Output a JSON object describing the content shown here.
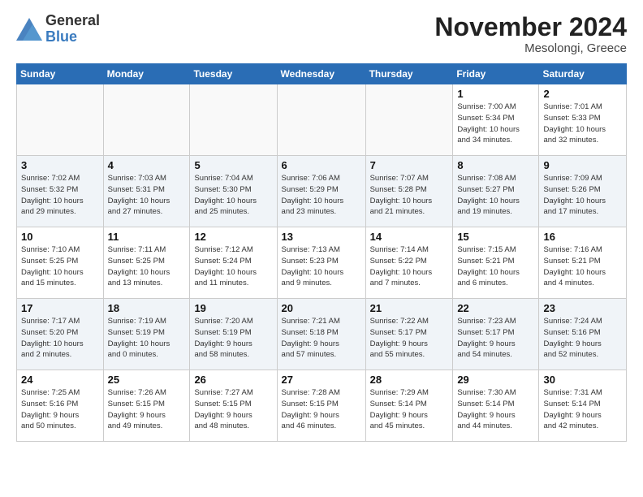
{
  "header": {
    "logo_general": "General",
    "logo_blue": "Blue",
    "month_title": "November 2024",
    "location": "Mesolongi, Greece"
  },
  "days_of_week": [
    "Sunday",
    "Monday",
    "Tuesday",
    "Wednesday",
    "Thursday",
    "Friday",
    "Saturday"
  ],
  "weeks": [
    [
      {
        "day": "",
        "info": ""
      },
      {
        "day": "",
        "info": ""
      },
      {
        "day": "",
        "info": ""
      },
      {
        "day": "",
        "info": ""
      },
      {
        "day": "",
        "info": ""
      },
      {
        "day": "1",
        "info": "Sunrise: 7:00 AM\nSunset: 5:34 PM\nDaylight: 10 hours\nand 34 minutes."
      },
      {
        "day": "2",
        "info": "Sunrise: 7:01 AM\nSunset: 5:33 PM\nDaylight: 10 hours\nand 32 minutes."
      }
    ],
    [
      {
        "day": "3",
        "info": "Sunrise: 7:02 AM\nSunset: 5:32 PM\nDaylight: 10 hours\nand 29 minutes."
      },
      {
        "day": "4",
        "info": "Sunrise: 7:03 AM\nSunset: 5:31 PM\nDaylight: 10 hours\nand 27 minutes."
      },
      {
        "day": "5",
        "info": "Sunrise: 7:04 AM\nSunset: 5:30 PM\nDaylight: 10 hours\nand 25 minutes."
      },
      {
        "day": "6",
        "info": "Sunrise: 7:06 AM\nSunset: 5:29 PM\nDaylight: 10 hours\nand 23 minutes."
      },
      {
        "day": "7",
        "info": "Sunrise: 7:07 AM\nSunset: 5:28 PM\nDaylight: 10 hours\nand 21 minutes."
      },
      {
        "day": "8",
        "info": "Sunrise: 7:08 AM\nSunset: 5:27 PM\nDaylight: 10 hours\nand 19 minutes."
      },
      {
        "day": "9",
        "info": "Sunrise: 7:09 AM\nSunset: 5:26 PM\nDaylight: 10 hours\nand 17 minutes."
      }
    ],
    [
      {
        "day": "10",
        "info": "Sunrise: 7:10 AM\nSunset: 5:25 PM\nDaylight: 10 hours\nand 15 minutes."
      },
      {
        "day": "11",
        "info": "Sunrise: 7:11 AM\nSunset: 5:25 PM\nDaylight: 10 hours\nand 13 minutes."
      },
      {
        "day": "12",
        "info": "Sunrise: 7:12 AM\nSunset: 5:24 PM\nDaylight: 10 hours\nand 11 minutes."
      },
      {
        "day": "13",
        "info": "Sunrise: 7:13 AM\nSunset: 5:23 PM\nDaylight: 10 hours\nand 9 minutes."
      },
      {
        "day": "14",
        "info": "Sunrise: 7:14 AM\nSunset: 5:22 PM\nDaylight: 10 hours\nand 7 minutes."
      },
      {
        "day": "15",
        "info": "Sunrise: 7:15 AM\nSunset: 5:21 PM\nDaylight: 10 hours\nand 6 minutes."
      },
      {
        "day": "16",
        "info": "Sunrise: 7:16 AM\nSunset: 5:21 PM\nDaylight: 10 hours\nand 4 minutes."
      }
    ],
    [
      {
        "day": "17",
        "info": "Sunrise: 7:17 AM\nSunset: 5:20 PM\nDaylight: 10 hours\nand 2 minutes."
      },
      {
        "day": "18",
        "info": "Sunrise: 7:19 AM\nSunset: 5:19 PM\nDaylight: 10 hours\nand 0 minutes."
      },
      {
        "day": "19",
        "info": "Sunrise: 7:20 AM\nSunset: 5:19 PM\nDaylight: 9 hours\nand 58 minutes."
      },
      {
        "day": "20",
        "info": "Sunrise: 7:21 AM\nSunset: 5:18 PM\nDaylight: 9 hours\nand 57 minutes."
      },
      {
        "day": "21",
        "info": "Sunrise: 7:22 AM\nSunset: 5:17 PM\nDaylight: 9 hours\nand 55 minutes."
      },
      {
        "day": "22",
        "info": "Sunrise: 7:23 AM\nSunset: 5:17 PM\nDaylight: 9 hours\nand 54 minutes."
      },
      {
        "day": "23",
        "info": "Sunrise: 7:24 AM\nSunset: 5:16 PM\nDaylight: 9 hours\nand 52 minutes."
      }
    ],
    [
      {
        "day": "24",
        "info": "Sunrise: 7:25 AM\nSunset: 5:16 PM\nDaylight: 9 hours\nand 50 minutes."
      },
      {
        "day": "25",
        "info": "Sunrise: 7:26 AM\nSunset: 5:15 PM\nDaylight: 9 hours\nand 49 minutes."
      },
      {
        "day": "26",
        "info": "Sunrise: 7:27 AM\nSunset: 5:15 PM\nDaylight: 9 hours\nand 48 minutes."
      },
      {
        "day": "27",
        "info": "Sunrise: 7:28 AM\nSunset: 5:15 PM\nDaylight: 9 hours\nand 46 minutes."
      },
      {
        "day": "28",
        "info": "Sunrise: 7:29 AM\nSunset: 5:14 PM\nDaylight: 9 hours\nand 45 minutes."
      },
      {
        "day": "29",
        "info": "Sunrise: 7:30 AM\nSunset: 5:14 PM\nDaylight: 9 hours\nand 44 minutes."
      },
      {
        "day": "30",
        "info": "Sunrise: 7:31 AM\nSunset: 5:14 PM\nDaylight: 9 hours\nand 42 minutes."
      }
    ]
  ]
}
